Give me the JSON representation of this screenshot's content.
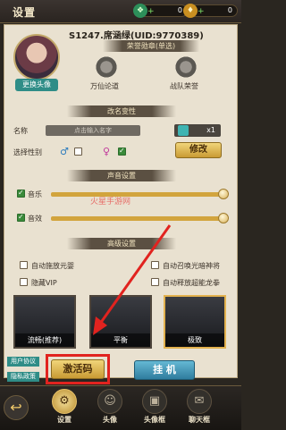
{
  "header": {
    "title": "设置",
    "currency_1": "0",
    "currency_2": "0"
  },
  "profile": {
    "username": "S1247.席涵绿(UID:9770389)",
    "change_avatar": "更换头像",
    "honor_title": "荣誉勋章(单选)",
    "medals": [
      {
        "label": "万仙论道"
      },
      {
        "label": "战队荣誉"
      }
    ]
  },
  "rename": {
    "section_title": "改名变性",
    "name_label": "名称",
    "name_placeholder": "点击输入名字",
    "item_count": "x1",
    "gender_label": "选择性别",
    "male_symbol": "♂",
    "female_symbol": "♀",
    "modify_button": "修改"
  },
  "sound": {
    "section_title": "声音设置",
    "music_label": "音乐",
    "sfx_label": "音效",
    "music_level": 1.0,
    "sfx_level": 1.0
  },
  "advanced": {
    "section_title": "高级设置",
    "options": [
      {
        "label": "自动施放元婴",
        "checked": false
      },
      {
        "label": "自动召唤光暗神将",
        "checked": false
      },
      {
        "label": "隐藏VIP",
        "checked": false
      },
      {
        "label": "自动释放超能龙拳",
        "checked": false
      }
    ],
    "quality": [
      {
        "label": "流畅(推荐)",
        "selected": false
      },
      {
        "label": "平衡",
        "selected": false
      },
      {
        "label": "极致",
        "selected": true
      }
    ]
  },
  "footer": {
    "user_agreement": "用户协议",
    "privacy_policy": "隐私政策",
    "activate_button": "激活码",
    "hangup_button": "挂 机"
  },
  "watermark": "火星手游网",
  "tabs": [
    {
      "label": "设置",
      "icon": "gear-icon",
      "active": true
    },
    {
      "label": "头像",
      "icon": "avatar-icon",
      "active": false
    },
    {
      "label": "头像框",
      "icon": "frame-icon",
      "active": false
    },
    {
      "label": "聊天框",
      "icon": "chat-bubble-icon",
      "active": false
    }
  ],
  "colors": {
    "accent_teal": "#2f8d87",
    "gold": "#d2a43d",
    "highlight_red": "#e1231f"
  }
}
